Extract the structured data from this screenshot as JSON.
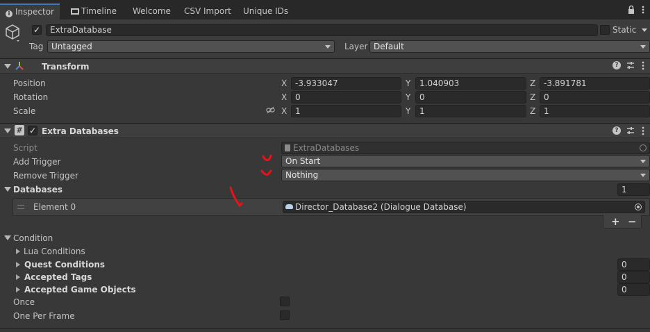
{
  "tabs": [
    {
      "label": "Inspector",
      "active": true
    },
    {
      "label": "Timeline"
    },
    {
      "label": "Welcome"
    },
    {
      "label": "CSV Import"
    },
    {
      "label": "Unique IDs"
    }
  ],
  "object": {
    "name": "ExtraDatabase",
    "enabled": true,
    "static_label": "Static",
    "tag_label": "Tag",
    "tag_value": "Untagged",
    "layer_label": "Layer",
    "layer_value": "Default"
  },
  "transform": {
    "title": "Transform",
    "rows": [
      {
        "label": "Position",
        "x": "-3.933047",
        "y": "1.040903",
        "z": "-3.891781"
      },
      {
        "label": "Rotation",
        "x": "0",
        "y": "0",
        "z": "0"
      },
      {
        "label": "Scale",
        "x": "1",
        "y": "1",
        "z": "1"
      }
    ],
    "axes": [
      "X",
      "Y",
      "Z"
    ]
  },
  "extra": {
    "title": "Extra Databases",
    "enabled": true,
    "script_label": "Script",
    "script_value": "ExtraDatabases",
    "add_trigger_label": "Add Trigger",
    "add_trigger_value": "On Start",
    "remove_trigger_label": "Remove Trigger",
    "remove_trigger_value": "Nothing",
    "databases_label": "Databases",
    "databases_count": "1",
    "element_label": "Element 0",
    "element_value": "Director_Database2 (Dialogue Database)",
    "add_symbol": "+",
    "remove_symbol": "−"
  },
  "condition": {
    "label": "Condition",
    "lua_label": "Lua Conditions",
    "quest_label": "Quest Conditions",
    "quest_value": "0",
    "tags_label": "Accepted Tags",
    "tags_value": "0",
    "gameobjects_label": "Accepted Game Objects",
    "gameobjects_value": "0",
    "once_label": "Once",
    "once_checked": false,
    "oneperframe_label": "One Per Frame",
    "oneperframe_checked": false
  },
  "colors": {
    "background": "#383838",
    "header": "#3e3e3e",
    "field": "#2a2a2a",
    "accent": "#3a79bb",
    "annotation": "#e8131a"
  }
}
